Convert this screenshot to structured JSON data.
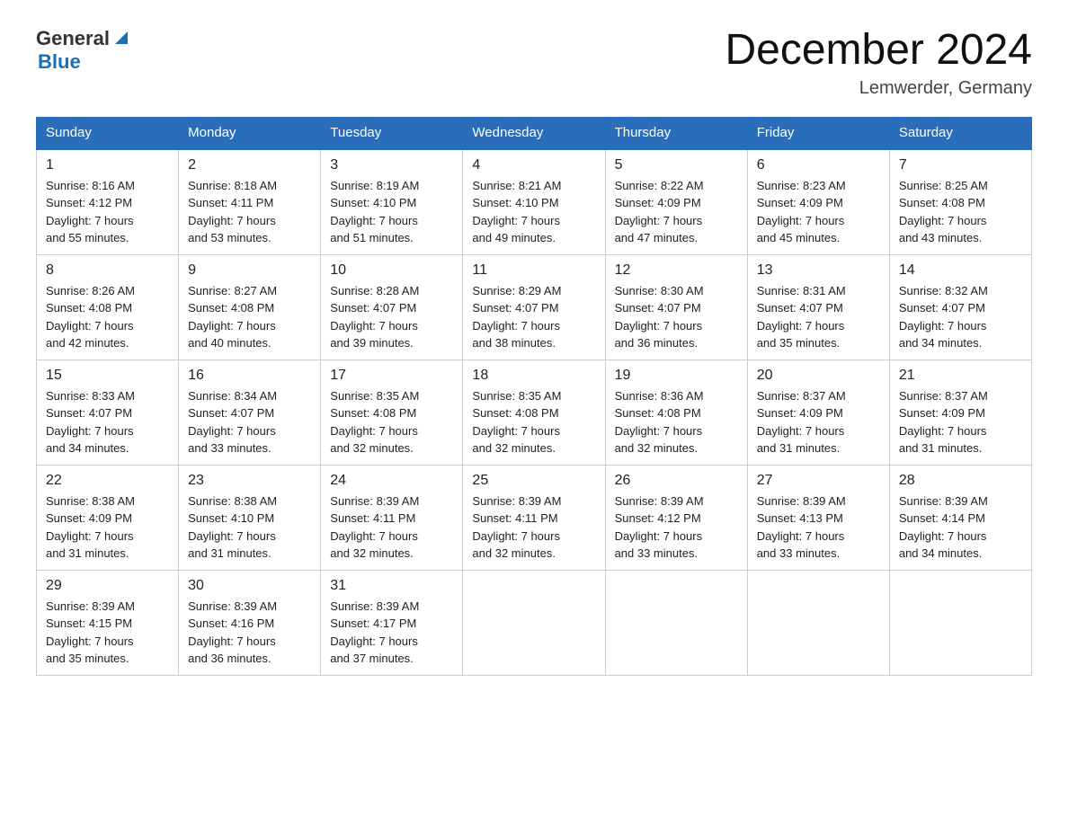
{
  "header": {
    "logo_general": "General",
    "logo_blue": "Blue",
    "title": "December 2024",
    "location": "Lemwerder, Germany"
  },
  "days_of_week": [
    "Sunday",
    "Monday",
    "Tuesday",
    "Wednesday",
    "Thursday",
    "Friday",
    "Saturday"
  ],
  "weeks": [
    [
      {
        "day": "1",
        "sunrise": "8:16 AM",
        "sunset": "4:12 PM",
        "daylight": "7 hours and 55 minutes."
      },
      {
        "day": "2",
        "sunrise": "8:18 AM",
        "sunset": "4:11 PM",
        "daylight": "7 hours and 53 minutes."
      },
      {
        "day": "3",
        "sunrise": "8:19 AM",
        "sunset": "4:10 PM",
        "daylight": "7 hours and 51 minutes."
      },
      {
        "day": "4",
        "sunrise": "8:21 AM",
        "sunset": "4:10 PM",
        "daylight": "7 hours and 49 minutes."
      },
      {
        "day": "5",
        "sunrise": "8:22 AM",
        "sunset": "4:09 PM",
        "daylight": "7 hours and 47 minutes."
      },
      {
        "day": "6",
        "sunrise": "8:23 AM",
        "sunset": "4:09 PM",
        "daylight": "7 hours and 45 minutes."
      },
      {
        "day": "7",
        "sunrise": "8:25 AM",
        "sunset": "4:08 PM",
        "daylight": "7 hours and 43 minutes."
      }
    ],
    [
      {
        "day": "8",
        "sunrise": "8:26 AM",
        "sunset": "4:08 PM",
        "daylight": "7 hours and 42 minutes."
      },
      {
        "day": "9",
        "sunrise": "8:27 AM",
        "sunset": "4:08 PM",
        "daylight": "7 hours and 40 minutes."
      },
      {
        "day": "10",
        "sunrise": "8:28 AM",
        "sunset": "4:07 PM",
        "daylight": "7 hours and 39 minutes."
      },
      {
        "day": "11",
        "sunrise": "8:29 AM",
        "sunset": "4:07 PM",
        "daylight": "7 hours and 38 minutes."
      },
      {
        "day": "12",
        "sunrise": "8:30 AM",
        "sunset": "4:07 PM",
        "daylight": "7 hours and 36 minutes."
      },
      {
        "day": "13",
        "sunrise": "8:31 AM",
        "sunset": "4:07 PM",
        "daylight": "7 hours and 35 minutes."
      },
      {
        "day": "14",
        "sunrise": "8:32 AM",
        "sunset": "4:07 PM",
        "daylight": "7 hours and 34 minutes."
      }
    ],
    [
      {
        "day": "15",
        "sunrise": "8:33 AM",
        "sunset": "4:07 PM",
        "daylight": "7 hours and 34 minutes."
      },
      {
        "day": "16",
        "sunrise": "8:34 AM",
        "sunset": "4:07 PM",
        "daylight": "7 hours and 33 minutes."
      },
      {
        "day": "17",
        "sunrise": "8:35 AM",
        "sunset": "4:08 PM",
        "daylight": "7 hours and 32 minutes."
      },
      {
        "day": "18",
        "sunrise": "8:35 AM",
        "sunset": "4:08 PM",
        "daylight": "7 hours and 32 minutes."
      },
      {
        "day": "19",
        "sunrise": "8:36 AM",
        "sunset": "4:08 PM",
        "daylight": "7 hours and 32 minutes."
      },
      {
        "day": "20",
        "sunrise": "8:37 AM",
        "sunset": "4:09 PM",
        "daylight": "7 hours and 31 minutes."
      },
      {
        "day": "21",
        "sunrise": "8:37 AM",
        "sunset": "4:09 PM",
        "daylight": "7 hours and 31 minutes."
      }
    ],
    [
      {
        "day": "22",
        "sunrise": "8:38 AM",
        "sunset": "4:09 PM",
        "daylight": "7 hours and 31 minutes."
      },
      {
        "day": "23",
        "sunrise": "8:38 AM",
        "sunset": "4:10 PM",
        "daylight": "7 hours and 31 minutes."
      },
      {
        "day": "24",
        "sunrise": "8:39 AM",
        "sunset": "4:11 PM",
        "daylight": "7 hours and 32 minutes."
      },
      {
        "day": "25",
        "sunrise": "8:39 AM",
        "sunset": "4:11 PM",
        "daylight": "7 hours and 32 minutes."
      },
      {
        "day": "26",
        "sunrise": "8:39 AM",
        "sunset": "4:12 PM",
        "daylight": "7 hours and 33 minutes."
      },
      {
        "day": "27",
        "sunrise": "8:39 AM",
        "sunset": "4:13 PM",
        "daylight": "7 hours and 33 minutes."
      },
      {
        "day": "28",
        "sunrise": "8:39 AM",
        "sunset": "4:14 PM",
        "daylight": "7 hours and 34 minutes."
      }
    ],
    [
      {
        "day": "29",
        "sunrise": "8:39 AM",
        "sunset": "4:15 PM",
        "daylight": "7 hours and 35 minutes."
      },
      {
        "day": "30",
        "sunrise": "8:39 AM",
        "sunset": "4:16 PM",
        "daylight": "7 hours and 36 minutes."
      },
      {
        "day": "31",
        "sunrise": "8:39 AM",
        "sunset": "4:17 PM",
        "daylight": "7 hours and 37 minutes."
      },
      null,
      null,
      null,
      null
    ]
  ],
  "labels": {
    "sunrise": "Sunrise:",
    "sunset": "Sunset:",
    "daylight": "Daylight:"
  }
}
